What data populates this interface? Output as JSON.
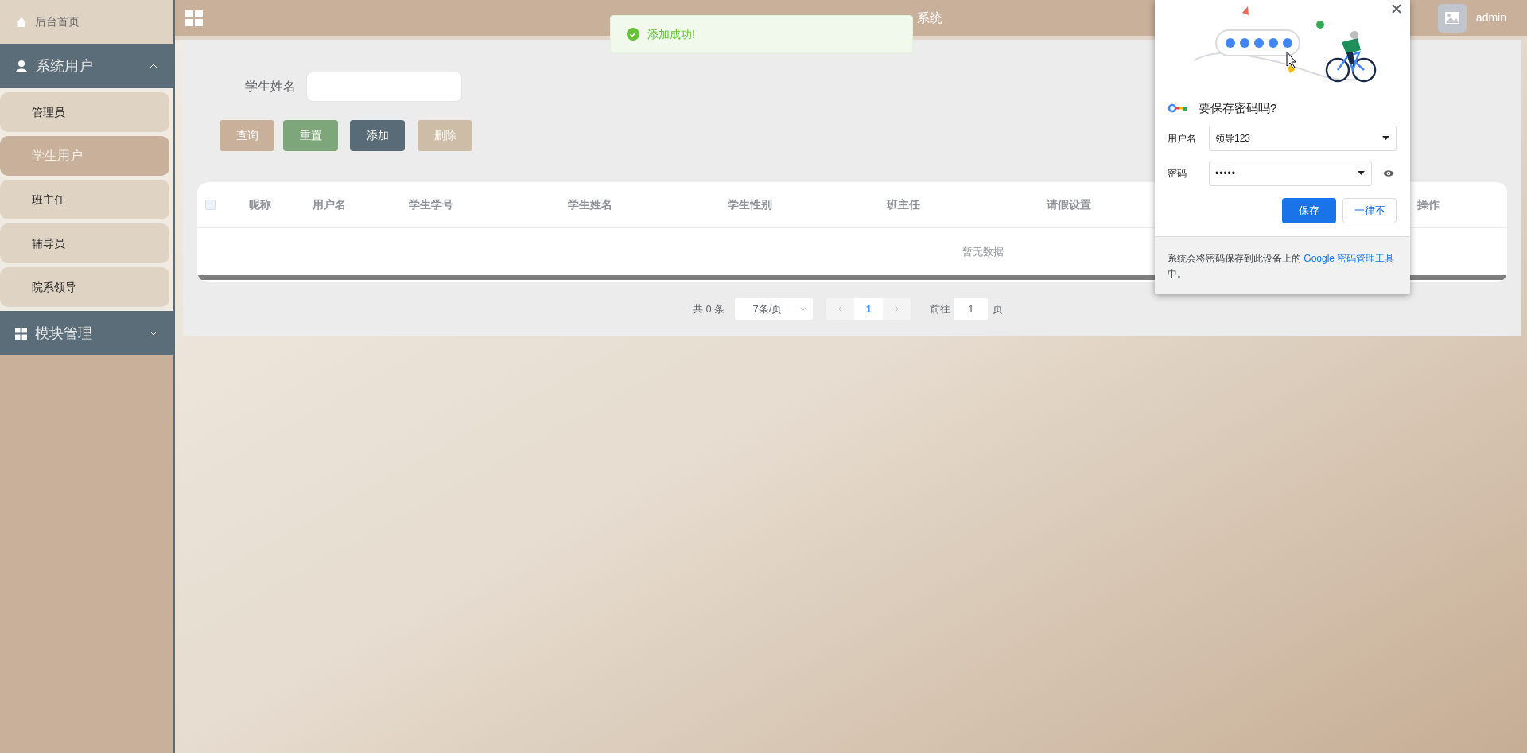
{
  "sidebar": {
    "items": [
      {
        "kind": "link",
        "label": "后台首页"
      },
      {
        "kind": "group",
        "label": "系统用户",
        "expanded": true,
        "children": [
          {
            "label": "管理员",
            "selected": false
          },
          {
            "label": "学生用户",
            "selected": true
          },
          {
            "label": "班主任",
            "selected": false
          },
          {
            "label": "辅导员",
            "selected": false
          },
          {
            "label": "院系领导",
            "selected": false
          }
        ]
      },
      {
        "kind": "group",
        "label": "模块管理",
        "expanded": false
      }
    ]
  },
  "header": {
    "title": "系统",
    "user": "admin"
  },
  "toast": {
    "message": "添加成功!"
  },
  "search": {
    "label": "学生姓名"
  },
  "buttons": [
    {
      "label": "查询",
      "kind": "query",
      "disabled": false
    },
    {
      "label": "重置",
      "kind": "reset",
      "disabled": false
    },
    {
      "label": "添加",
      "kind": "add",
      "disabled": false
    },
    {
      "label": "删除",
      "kind": "delete",
      "disabled": true
    }
  ],
  "table": {
    "select_all_checked": false,
    "columns": [
      "昵称",
      "用户名",
      "学生学号",
      "学生姓名",
      "学生性别",
      "班主任",
      "请假设置",
      "操作"
    ],
    "empty_text": "暂无数据"
  },
  "pagination": {
    "total": "共 0 条",
    "page_size": "7条/页",
    "pages": [
      {
        "label": "1",
        "selected": true
      }
    ],
    "goto_label": "前往",
    "goto_value": "1",
    "goto_suffix": "页"
  },
  "password_dialog": {
    "title": "要保存密码吗?",
    "fields": [
      {
        "label": "用户名",
        "value": "领导123",
        "kind": "text"
      },
      {
        "label": "密码",
        "value": "•••••",
        "kind": "password"
      }
    ],
    "save": "保存",
    "never": "一律不",
    "footer": "系统会将密码保存到此设备上的 ",
    "footer_link": "Google 密码管理工具",
    "footer_end": "中。"
  }
}
